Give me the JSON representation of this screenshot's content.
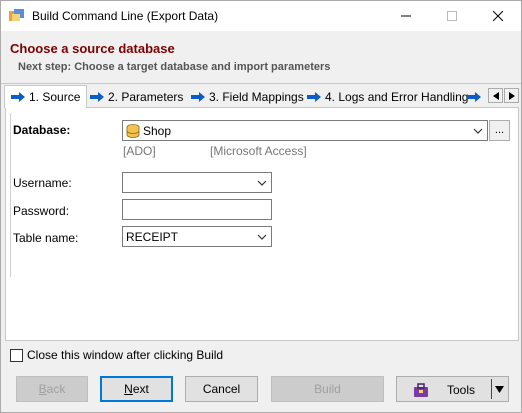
{
  "window": {
    "title": "Build Command Line (Export Data)",
    "controls": {
      "minimize": "minimize-icon",
      "maximize": "maximize-icon",
      "close": "close-icon"
    }
  },
  "header": {
    "title": "Choose a source database",
    "subtitle": "Next step: Choose a target database and import parameters"
  },
  "tabs": [
    {
      "label": "1. Source",
      "active": true
    },
    {
      "label": "2. Parameters",
      "active": false
    },
    {
      "label": "3. Field Mappings",
      "active": false
    },
    {
      "label": "4. Logs and Error Handling",
      "active": false
    }
  ],
  "form": {
    "database_label": "Database:",
    "database_value": "Shop",
    "database_browse": "...",
    "driver_hint": "[ADO]",
    "type_hint": "[Microsoft Access]",
    "username_label": "Username:",
    "username_value": "",
    "password_label": "Password:",
    "password_value": "",
    "table_label": "Table name:",
    "table_value": "RECEIPT"
  },
  "options": {
    "close_after_build_label": "Close this window after clicking Build",
    "close_after_build_checked": false
  },
  "buttons": {
    "back": "Back",
    "next": "Next",
    "cancel": "Cancel",
    "build": "Build",
    "tools": "Tools"
  },
  "colors": {
    "header_title": "#7f0000",
    "tab_arrow": "#0a5cc7",
    "default_button_border": "#0078d7"
  }
}
